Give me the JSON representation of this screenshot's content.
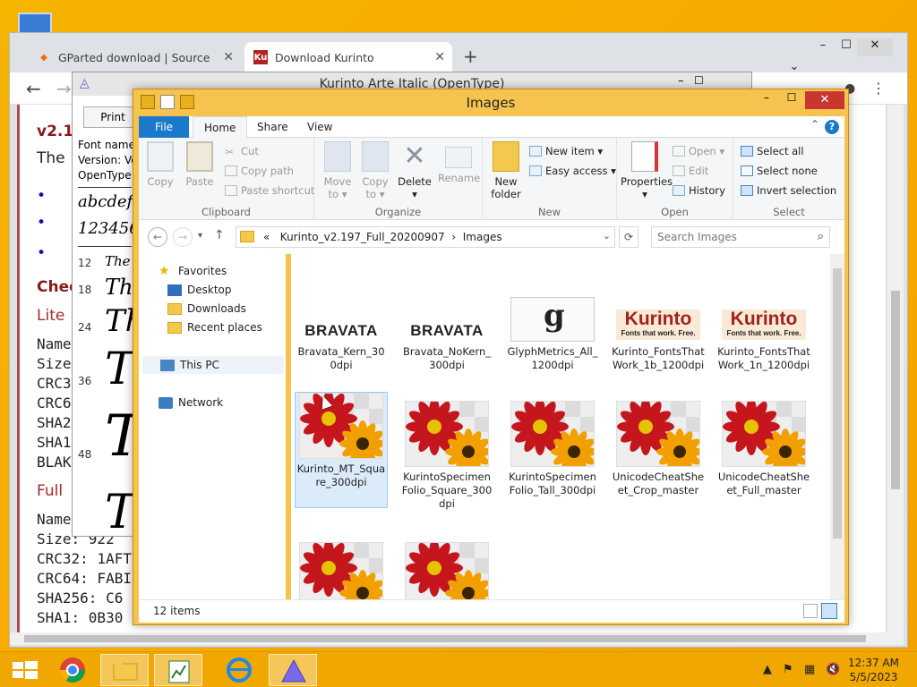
{
  "chrome": {
    "tabs": [
      {
        "label": "GParted download | SourceForge",
        "favicon": "sourceforge-icon",
        "color": "#ff6600"
      },
      {
        "label": "Download Kurinto",
        "favicon": "kurinto-icon",
        "color": "#b22222"
      }
    ],
    "page": {
      "heading": "v2.1",
      "line1": "The",
      "check_heading": "Chec",
      "lite_heading": "Lite",
      "lite_rows": [
        "Name",
        "Size",
        "CRC3",
        "CRC6",
        "SHA2",
        "SHA1",
        "BLAK"
      ],
      "full_heading": "Full",
      "full_rows": [
        "Name",
        "Size: 922",
        "CRC32: 1AFT",
        "CRC64: FABI",
        "SHA256: C6",
        "SHA1: 0B30"
      ]
    }
  },
  "fontviewer": {
    "title": "Kurinto Arte Italic (OpenType)",
    "print_label": "Print",
    "info": [
      "Font name",
      "Version: Ve",
      "OpenType"
    ],
    "sample_alpha": "abcdef",
    "sample_digits": "123456",
    "sizes": [
      {
        "size": "12",
        "text": "The"
      },
      {
        "size": "18",
        "text": "The"
      },
      {
        "size": "24",
        "text": "Th"
      },
      {
        "size": "36",
        "text": "T"
      },
      {
        "size": "48",
        "text": "T"
      },
      {
        "size": "",
        "text": "T"
      }
    ]
  },
  "explorer": {
    "title": "Images",
    "tabs": {
      "file": "File",
      "home": "Home",
      "share": "Share",
      "view": "View"
    },
    "ribbon": {
      "clipboard": {
        "label": "Clipboard",
        "copy": "Copy",
        "paste": "Paste",
        "cut": "Cut",
        "copy_path": "Copy path",
        "paste_shortcut": "Paste shortcut"
      },
      "organize": {
        "label": "Organize",
        "move_to": "Move",
        "move_to2": "to ▾",
        "copy_to": "Copy",
        "copy_to2": "to ▾",
        "delete": "Delete",
        "delete2": "▾",
        "rename": "Rename"
      },
      "new": {
        "label": "New",
        "new_folder": "New",
        "new_folder2": "folder",
        "new_item": "New item ▾",
        "easy_access": "Easy access ▾"
      },
      "open": {
        "label": "Open",
        "properties": "Properties",
        "properties2": "▾",
        "open": "Open ▾",
        "edit": "Edit",
        "history": "History"
      },
      "select": {
        "label": "Select",
        "select_all": "Select all",
        "select_none": "Select none",
        "invert": "Invert selection"
      }
    },
    "address": {
      "prefix": "«",
      "crumb1": "Kurinto_v2.197_Full_20200907",
      "sep": "›",
      "crumb2": "Images",
      "search_placeholder": "Search Images"
    },
    "nav": {
      "favorites": "Favorites",
      "desktop": "Desktop",
      "downloads": "Downloads",
      "recent": "Recent places",
      "thispc": "This PC",
      "network": "Network"
    },
    "files": [
      {
        "name": "Bravata_Kern_300dpi",
        "thumb": "BRAVATA"
      },
      {
        "name": "Bravata_NoKern_300dpi",
        "thumb": "BRAVATA"
      },
      {
        "name": "GlyphMetrics_All_1200dpi",
        "thumb": "g"
      },
      {
        "name": "Kurinto_FontsThatWork_1b_1200dpi",
        "thumb": "Kurinto",
        "sub": "Fonts that work. Free."
      },
      {
        "name": "Kurinto_FontsThatWork_1n_1200dpi",
        "thumb": "Kurinto",
        "sub": "Fonts that work. Free."
      },
      {
        "name": "Kurinto_MT_Square_300dpi",
        "thumb": "flower"
      },
      {
        "name": "KurintoSpecimenFolio_Square_300dpi",
        "thumb": "flower"
      },
      {
        "name": "KurintoSpecimenFolio_Tall_300dpi",
        "thumb": "flower"
      },
      {
        "name": "UnicodeCheatSheet_Crop_master",
        "thumb": "flower"
      },
      {
        "name": "UnicodeCheatSheet_Full_master",
        "thumb": "flower"
      },
      {
        "name": "",
        "thumb": "flower"
      },
      {
        "name": "",
        "thumb": "flower"
      }
    ],
    "status": "12 items"
  },
  "taskbar": {
    "time": "12:37 AM",
    "date": "5/5/2023"
  }
}
